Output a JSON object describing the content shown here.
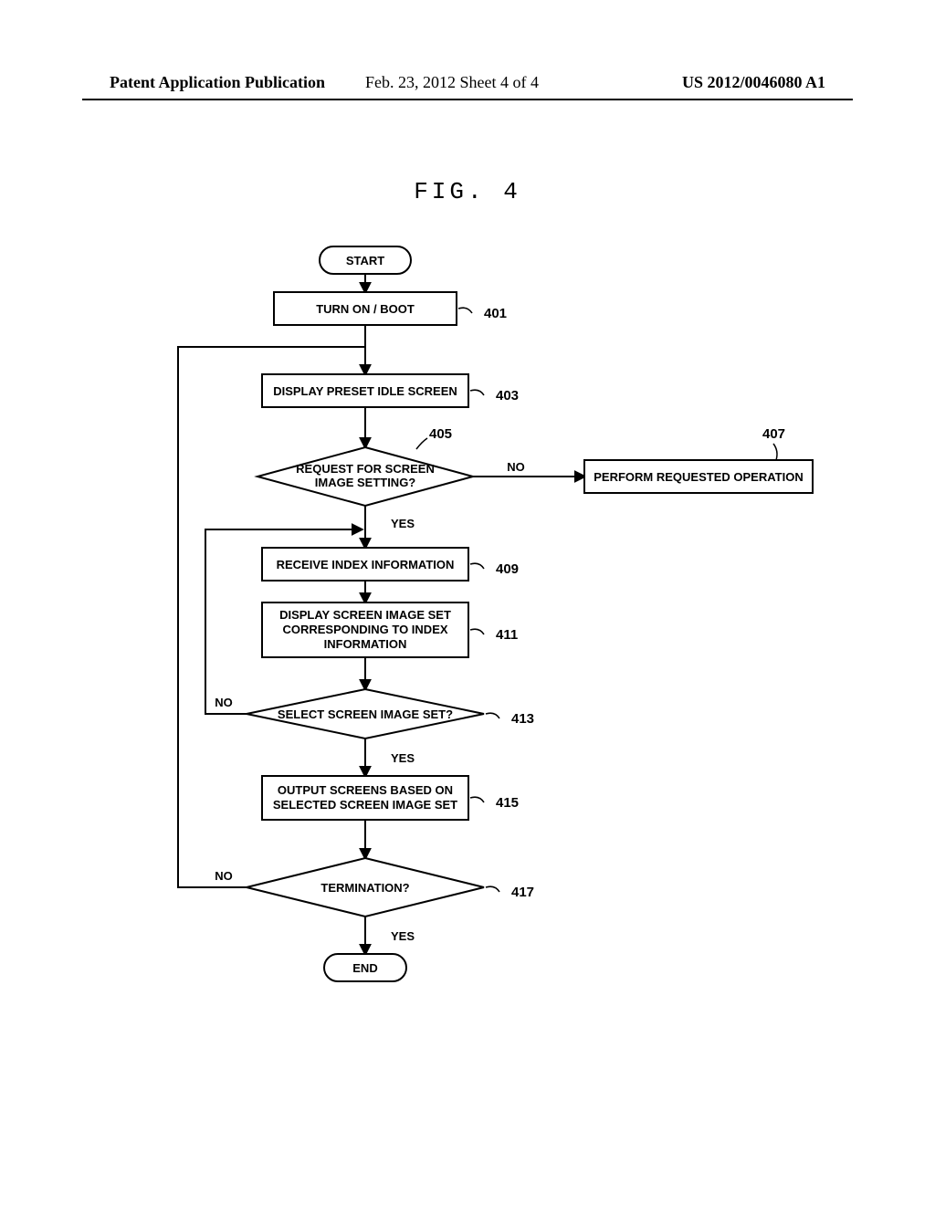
{
  "header": {
    "left": "Patent Application Publication",
    "middle": "Feb. 23, 2012  Sheet 4 of 4",
    "right": "US 2012/0046080 A1"
  },
  "figure_label": "FIG. 4",
  "flow": {
    "start": "START",
    "end": "END",
    "n401": "TURN ON / BOOT",
    "n403": "DISPLAY PRESET IDLE SCREEN",
    "n405_l1": "REQUEST FOR SCREEN",
    "n405_l2": "IMAGE SETTING?",
    "n407": "PERFORM REQUESTED OPERATION",
    "n409": "RECEIVE INDEX INFORMATION",
    "n411_l1": "DISPLAY SCREEN IMAGE SET",
    "n411_l2": "CORRESPONDING TO INDEX",
    "n411_l3": "INFORMATION",
    "n413": "SELECT SCREEN IMAGE SET?",
    "n415_l1": "OUTPUT SCREENS BASED ON",
    "n415_l2": "SELECTED SCREEN IMAGE SET",
    "n417": "TERMINATION?",
    "yes": "YES",
    "no": "NO",
    "r401": "401",
    "r403": "403",
    "r405": "405",
    "r407": "407",
    "r409": "409",
    "r411": "411",
    "r413": "413",
    "r415": "415",
    "r417": "417"
  }
}
